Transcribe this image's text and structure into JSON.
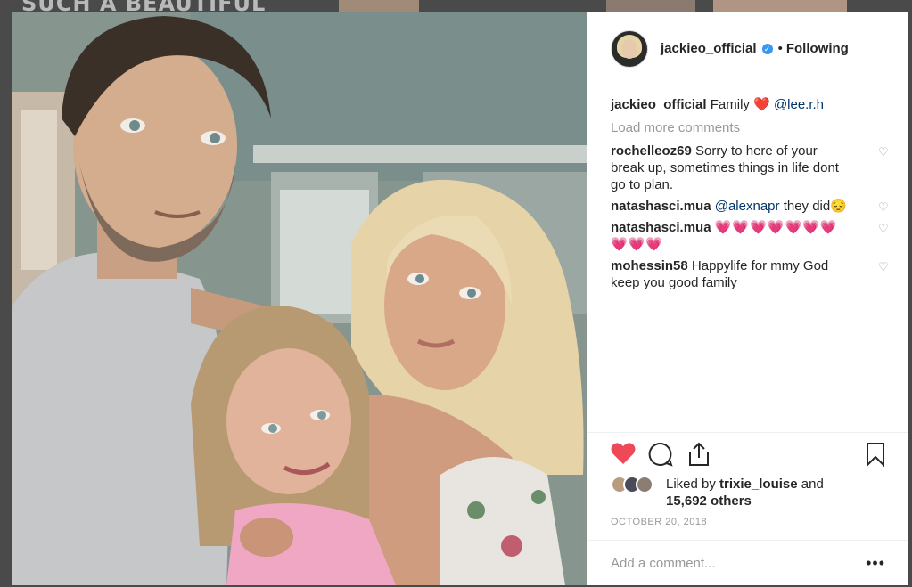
{
  "background": {
    "headline": "SUCH A BEAUTIFUL"
  },
  "post": {
    "username": "jackieo_official",
    "follow_label": "Following",
    "dot": "•",
    "caption": {
      "username": "jackieo_official",
      "text": "Family",
      "emoji": "❤️",
      "mention": "@lee.r.h"
    },
    "load_more": "Load more comments",
    "comments": [
      {
        "username": "rochelleoz69",
        "text": "Sorry to here of your break up, sometimes things in life dont go to plan."
      },
      {
        "username": "natashasci.mua",
        "mention": "@alexnapr",
        "text": "they did😔"
      },
      {
        "username": "natashasci.mua",
        "text": "💗💗💗💗💗💗💗💗💗💗"
      },
      {
        "username": "mohessin58",
        "text": "Happylife for mmy God keep you good family"
      }
    ],
    "likes": {
      "prefix": "Liked by",
      "user": "trixie_louise",
      "and": "and",
      "others": "15,692 others"
    },
    "date": "OCTOBER 20, 2018",
    "add_comment_placeholder": "Add a comment...",
    "more_label": "•••"
  },
  "icons": {
    "like": "heart-filled-icon",
    "comment": "comment-bubble-icon",
    "share": "share-icon",
    "save": "bookmark-icon",
    "comment_like": "heart-outline-icon"
  },
  "colors": {
    "like_red": "#ed4956",
    "verified_blue": "#3897f0",
    "text": "#262626",
    "muted": "#999999",
    "mention": "#003569"
  }
}
